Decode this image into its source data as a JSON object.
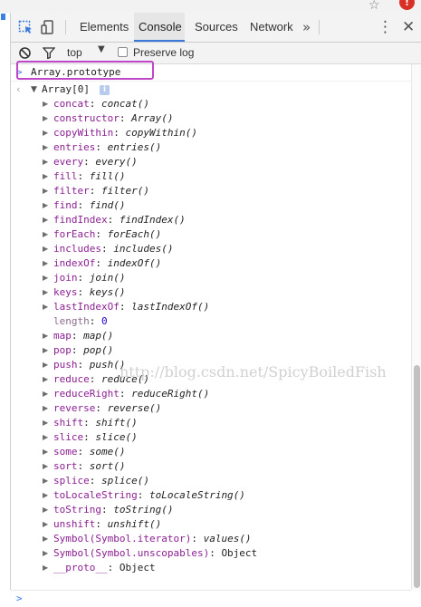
{
  "icons": {
    "star": "star-icon",
    "alert": "alert-icon",
    "inspect": "inspect-element-icon",
    "device": "device-toolbar-icon",
    "clear": "clear-console-icon",
    "filter": "filter-icon",
    "more_tabs": "more-tabs-icon",
    "kebab": "kebab-menu-icon",
    "close": "close-icon"
  },
  "colors": {
    "accent": "#3879d9",
    "highlight": "#c046c9",
    "property_key": "#8b1e92",
    "number": "#1c00cf",
    "alert": "#d93025"
  },
  "browser": {
    "alert_glyph": "!",
    "star_glyph": "☆"
  },
  "tabs": {
    "elements": "Elements",
    "console": "Console",
    "sources": "Sources",
    "network": "Network",
    "more": "»"
  },
  "toolbar": {
    "context": "top",
    "preserve_log": "Preserve log",
    "preserve_log_checked": false
  },
  "console": {
    "command": "Array.prototype",
    "result_label": "Array[0]",
    "info_badge": "i",
    "properties": [
      {
        "key": "concat",
        "value": "concat()",
        "kind": "func",
        "expandable": true
      },
      {
        "key": "constructor",
        "value": "Array()",
        "kind": "func",
        "expandable": true
      },
      {
        "key": "copyWithin",
        "value": "copyWithin()",
        "kind": "func",
        "expandable": true
      },
      {
        "key": "entries",
        "value": "entries()",
        "kind": "func",
        "expandable": true
      },
      {
        "key": "every",
        "value": "every()",
        "kind": "func",
        "expandable": true
      },
      {
        "key": "fill",
        "value": "fill()",
        "kind": "func",
        "expandable": true
      },
      {
        "key": "filter",
        "value": "filter()",
        "kind": "func",
        "expandable": true
      },
      {
        "key": "find",
        "value": "find()",
        "kind": "func",
        "expandable": true
      },
      {
        "key": "findIndex",
        "value": "findIndex()",
        "kind": "func",
        "expandable": true
      },
      {
        "key": "forEach",
        "value": "forEach()",
        "kind": "func",
        "expandable": true
      },
      {
        "key": "includes",
        "value": "includes()",
        "kind": "func",
        "expandable": true
      },
      {
        "key": "indexOf",
        "value": "indexOf()",
        "kind": "func",
        "expandable": true
      },
      {
        "key": "join",
        "value": "join()",
        "kind": "func",
        "expandable": true
      },
      {
        "key": "keys",
        "value": "keys()",
        "kind": "func",
        "expandable": true
      },
      {
        "key": "lastIndexOf",
        "value": "lastIndexOf()",
        "kind": "func",
        "expandable": true
      },
      {
        "key": "length",
        "value": "0",
        "kind": "num",
        "expandable": false
      },
      {
        "key": "map",
        "value": "map()",
        "kind": "func",
        "expandable": true
      },
      {
        "key": "pop",
        "value": "pop()",
        "kind": "func",
        "expandable": true
      },
      {
        "key": "push",
        "value": "push()",
        "kind": "func",
        "expandable": true
      },
      {
        "key": "reduce",
        "value": "reduce()",
        "kind": "func",
        "expandable": true
      },
      {
        "key": "reduceRight",
        "value": "reduceRight()",
        "kind": "func",
        "expandable": true
      },
      {
        "key": "reverse",
        "value": "reverse()",
        "kind": "func",
        "expandable": true
      },
      {
        "key": "shift",
        "value": "shift()",
        "kind": "func",
        "expandable": true
      },
      {
        "key": "slice",
        "value": "slice()",
        "kind": "func",
        "expandable": true
      },
      {
        "key": "some",
        "value": "some()",
        "kind": "func",
        "expandable": true
      },
      {
        "key": "sort",
        "value": "sort()",
        "kind": "func",
        "expandable": true
      },
      {
        "key": "splice",
        "value": "splice()",
        "kind": "func",
        "expandable": true
      },
      {
        "key": "toLocaleString",
        "value": "toLocaleString()",
        "kind": "func",
        "expandable": true
      },
      {
        "key": "toString",
        "value": "toString()",
        "kind": "func",
        "expandable": true
      },
      {
        "key": "unshift",
        "value": "unshift()",
        "kind": "func",
        "expandable": true
      },
      {
        "key": "Symbol(Symbol.iterator)",
        "value": "values()",
        "kind": "func",
        "expandable": true
      },
      {
        "key": "Symbol(Symbol.unscopables)",
        "value": "Object",
        "kind": "plain",
        "expandable": true
      },
      {
        "key": "__proto__",
        "value": "Object",
        "kind": "plain",
        "expandable": true
      }
    ],
    "watermark": "http://blog.csdn.net/SpicyBoiledFish"
  }
}
